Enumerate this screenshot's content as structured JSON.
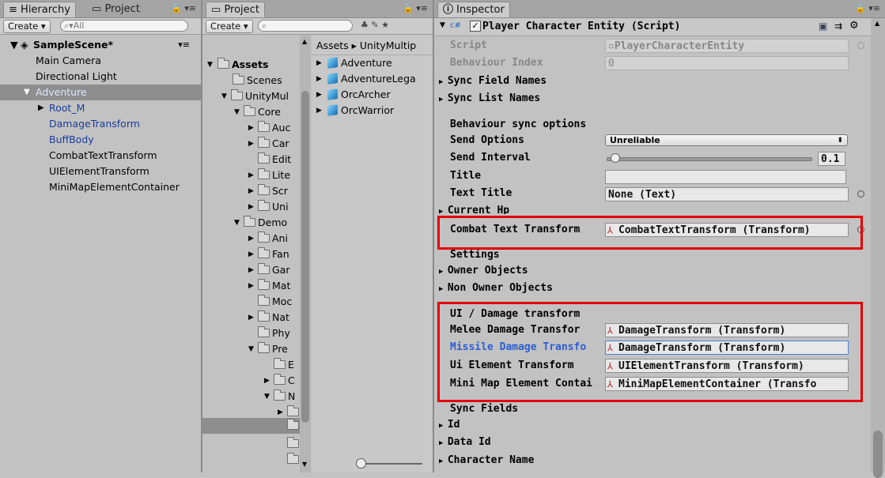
{
  "hierarchy": {
    "tab_label": "Hierarchy",
    "tab2_label": "Project",
    "create_label": "Create",
    "search_placeholder": "All",
    "scene_name": "SampleScene*",
    "items": [
      "Main Camera",
      "Directional Light",
      "Adventure",
      "Root_M",
      "DamageTransform",
      "BuffBody",
      "CombatTextTransform",
      "UIElementTransform",
      "MiniMapElementContainer"
    ]
  },
  "project": {
    "tab_label": "Project",
    "create_label": "Create",
    "breadcrumb": "Assets ▸ UnityMultip",
    "tree": [
      "Assets",
      "Scenes",
      "UnityMul",
      "Core",
      "Auc",
      "Car",
      "Edit",
      "Lite",
      "Scr",
      "Uni",
      "Demo",
      "Ani",
      "Fan",
      "Gar",
      "Mat",
      "Moc",
      "Nat",
      "Phy",
      "Pre",
      "E",
      "C",
      "N"
    ],
    "assets": [
      "Adventure",
      "AdventureLega",
      "OrcArcher",
      "OrcWarrior"
    ]
  },
  "inspector": {
    "tab_label": "Inspector",
    "component_title": "Player Character Entity (Script)",
    "script_label": "Script",
    "script_value": "PlayerCharacterEntity",
    "behaviour_index_label": "Behaviour Index",
    "behaviour_index_value": "0",
    "sync_field_names": "Sync Field Names",
    "sync_list_names": "Sync List Names",
    "behaviour_sync_options": "Behaviour sync options",
    "send_options_label": "Send Options",
    "send_options_value": "Unreliable",
    "send_interval_label": "Send Interval",
    "send_interval_value": "0.1",
    "title_label": "Title",
    "text_title_label": "Text Title",
    "text_title_value": "None (Text)",
    "current_hp": "Current Hp",
    "combat_text_label": "Combat Text Transform",
    "combat_text_value": "CombatTextTransform (Transform)",
    "settings": "Settings",
    "owner_objects": "Owner Objects",
    "non_owner_objects": "Non Owner Objects",
    "ui_damage_header": "UI / Damage transform",
    "melee_label": "Melee Damage Transfor",
    "melee_value": "DamageTransform (Transform)",
    "missile_label": "Missile Damage Transfo",
    "missile_value": "DamageTransform (Transform)",
    "ui_element_label": "Ui Element Transform",
    "ui_element_value": "UIElementTransform (Transform)",
    "minimap_label": "Mini Map Element Contai",
    "minimap_value": "MiniMapElementContainer (Transfo",
    "sync_fields": "Sync Fields",
    "id": "Id",
    "data_id": "Data Id",
    "character_name": "Character Name",
    "send_interval_slider_fraction": 0.02
  },
  "colors": {
    "highlight_box": "#e30000",
    "selected_row": "#8e8e8e",
    "link_blue": "#1a3c9c"
  }
}
